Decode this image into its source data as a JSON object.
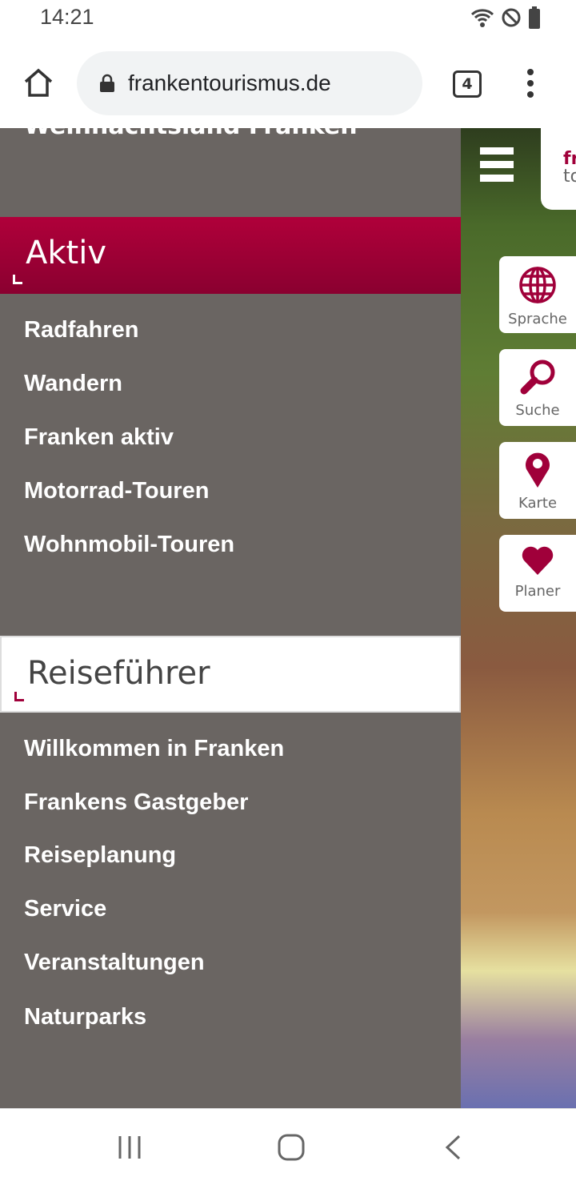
{
  "status": {
    "time": "14:21"
  },
  "browser": {
    "url": "frankentourismus.de",
    "tab_count": "4"
  },
  "nav": {
    "cut_item": "Weihnachtsland Franken",
    "sections": [
      {
        "title": "Aktiv",
        "items": [
          "Radfahren",
          "Wandern",
          "Franken aktiv",
          "Motorrad-Touren",
          "Wohnmobil-Touren"
        ]
      },
      {
        "title": "Reiseführer",
        "items": [
          "Willkommen in Franken",
          "Frankens Gastgeber",
          "Reiseplanung",
          "Service",
          "Veranstaltungen",
          "Naturparks"
        ]
      }
    ]
  },
  "logo": {
    "line1": "fr",
    "line2": "to"
  },
  "side_buttons": [
    {
      "label": "Sprache",
      "icon": "globe-icon"
    },
    {
      "label": "Suche",
      "icon": "search-icon"
    },
    {
      "label": "Karte",
      "icon": "map-pin-icon"
    },
    {
      "label": "Planer",
      "icon": "heart-icon"
    }
  ],
  "colors": {
    "accent": "#a0003a",
    "nav_bg": "#6a6562"
  }
}
